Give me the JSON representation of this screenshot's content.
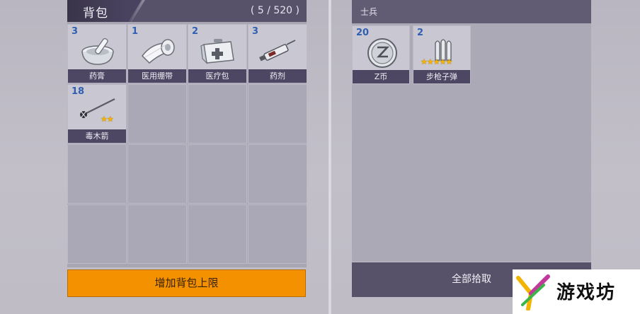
{
  "bag": {
    "title": "背包",
    "capacity": "( 5 / 520 )",
    "items": [
      {
        "count": "3",
        "label": "药膏",
        "icon": "mortar-pestle-icon",
        "stars": ""
      },
      {
        "count": "1",
        "label": "医用绷带",
        "icon": "bandage-roll-icon",
        "stars": ""
      },
      {
        "count": "2",
        "label": "医疗包",
        "icon": "medical-kit-icon",
        "stars": ""
      },
      {
        "count": "3",
        "label": "药剂",
        "icon": "syringe-icon",
        "stars": ""
      },
      {
        "count": "18",
        "label": "毒木箭",
        "icon": "poison-arrow-icon",
        "stars": "★★"
      }
    ],
    "expand_button": "增加背包上限"
  },
  "loot": {
    "title": "士兵",
    "items": [
      {
        "count": "20",
        "label": "Z币",
        "icon": "z-coin-icon",
        "stars": ""
      },
      {
        "count": "2",
        "label": "步枪子弹",
        "icon": "rifle-bullets-icon",
        "stars": "★★★★★"
      }
    ],
    "collect_button": "全部拾取"
  },
  "watermark": {
    "text": "游戏坊",
    "logo": "stylized-y-logo-icon"
  },
  "colors": {
    "count_blue": "#2f5fb0",
    "orange_button": "#f39100",
    "header_purple": "#57516a",
    "star_gold": "#f5b400"
  }
}
